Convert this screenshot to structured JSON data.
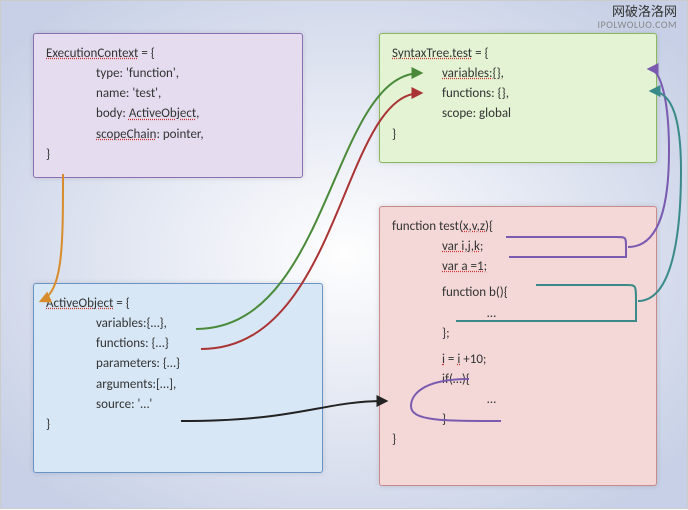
{
  "watermark": {
    "line1": "网破洛洛网",
    "line2": "IPOLWOLUO.COM"
  },
  "purple": {
    "title": "ExecutionContext",
    "eq": " = {",
    "l1": "type: 'function',",
    "l2": "name: 'test',",
    "l3a": "body:  ",
    "l3b": "ActiveObject",
    "l3c": ",",
    "l4a": "scopeChain",
    "l4b": ": pointer,",
    "close": "}"
  },
  "green": {
    "title": "SyntaxTree.test",
    "eq": " = {",
    "l1a": "variables:{},",
    "l2a": "functions: {},",
    "l3": "scope: global",
    "close": "}"
  },
  "blue": {
    "title": "ActiveObject",
    "eq": " = {",
    "l1": "variables:{…},",
    "l2": "functions: {…}",
    "l3": "parameters: {…}",
    "l4": "arguments:[…],",
    "l5": "source: '…'",
    "close": "}"
  },
  "red": {
    "l1a": "function test(",
    "l1b": "x,v,z",
    "l1c": "){",
    "l2a": "var",
    "l2b": " i,j,k",
    "l2c": ";",
    "l3a": "var",
    "l3b": " a =1;",
    "l4": "function b(){",
    "l5": "…",
    "l6": "};",
    "l7a": "i",
    "l7b": " = ",
    "l7c": "i",
    "l7d": " +10;",
    "l8": "if(…){",
    "l9": "…",
    "l10": "}",
    "close": "}"
  }
}
